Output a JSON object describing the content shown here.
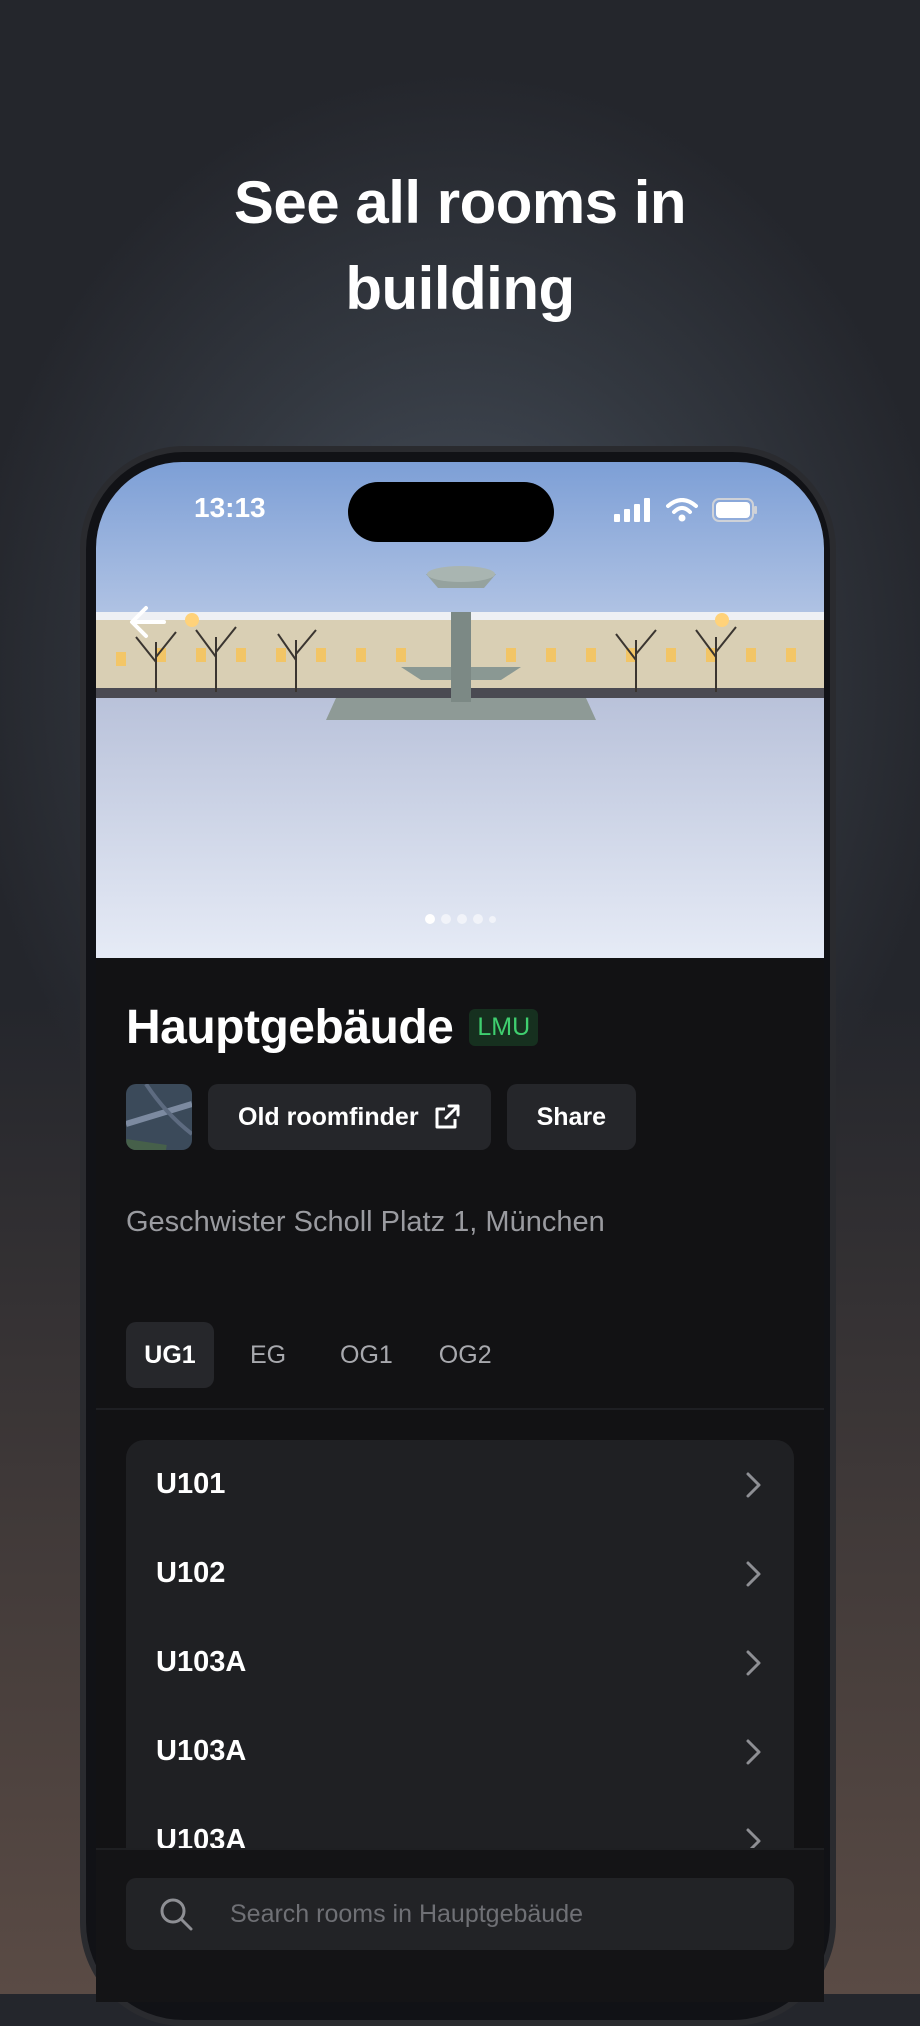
{
  "headline": {
    "line1": "See all rooms in",
    "line2": "building"
  },
  "status_bar": {
    "time": "13:13"
  },
  "hero": {
    "carousel_total": 5,
    "carousel_index": 1
  },
  "building": {
    "name": "Hauptgebäude",
    "badge": "LMU",
    "address": "Geschwister Scholl Platz 1, München"
  },
  "actions": {
    "old_roomfinder_label": "Old roomfinder",
    "share_label": "Share"
  },
  "floor_tabs": [
    {
      "label": "UG1",
      "active": true
    },
    {
      "label": "EG",
      "active": false
    },
    {
      "label": "OG1",
      "active": false
    },
    {
      "label": "OG2",
      "active": false
    }
  ],
  "rooms": [
    "U101",
    "U102",
    "U103A",
    "U103A",
    "U103A"
  ],
  "search": {
    "placeholder": "Search rooms in Hauptgebäude"
  },
  "colors": {
    "accent_green": "#3fcf6f",
    "surface": "#1f2023",
    "background": "#121214"
  }
}
